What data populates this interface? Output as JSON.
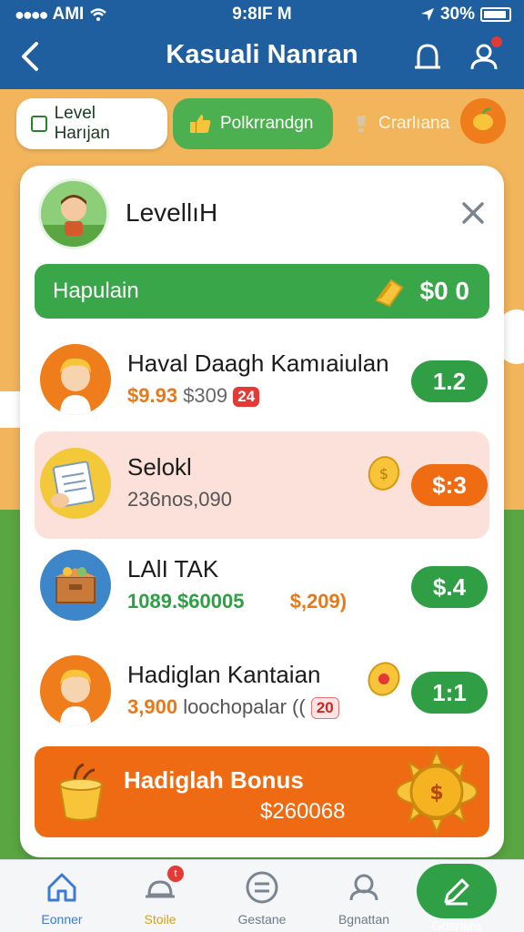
{
  "status": {
    "carrier": "AMI",
    "time": "9:8IF M",
    "battery": "30%"
  },
  "header": {
    "title": "Kasuali Nanran"
  },
  "tabs": [
    {
      "label": "Level Harıjan"
    },
    {
      "label": "Polkrrandgn"
    },
    {
      "label": "Crarlıana"
    }
  ],
  "card": {
    "title": "LevellıH",
    "summary": {
      "label": "Hapulain",
      "value": "$0 0"
    },
    "rows": [
      {
        "name": "Haval Daagh Kamıaiulan",
        "amount": "$9.93",
        "secondary": "$309",
        "badge": "24",
        "score": "1.2",
        "highlight": false,
        "pill_color": "green"
      },
      {
        "name": "Selokl",
        "amount": "236nos,090",
        "score": "$:3",
        "highlight": true,
        "pill_color": "orange"
      },
      {
        "name": "LAlI TAK",
        "amount": "1089.$60005",
        "secondary": "$,209",
        "score": "$.4",
        "highlight": false,
        "pill_color": "green"
      },
      {
        "name": "Hadiglan Kantaian",
        "amount": "3,900",
        "secondary": "loochopalar",
        "badge": "20",
        "score": "1:1",
        "highlight": false,
        "pill_color": "green"
      }
    ],
    "bonus": {
      "title": "Hadiglah Bonus",
      "amount": "$260068"
    }
  },
  "nav": [
    {
      "label": "Eonner",
      "icon": "home-icon"
    },
    {
      "label": "Stoile",
      "icon": "hat-icon",
      "badge": "t"
    },
    {
      "label": "Gestane",
      "icon": "menu-circle-icon"
    },
    {
      "label": "Bgnattan",
      "icon": "profile-icon"
    },
    {
      "label": "Goanere",
      "icon": "edit-icon"
    }
  ],
  "colors": {
    "header": "#1f5fa0",
    "green": "#2f9e44",
    "orange": "#ef6c12",
    "background": "#f2b55c"
  }
}
